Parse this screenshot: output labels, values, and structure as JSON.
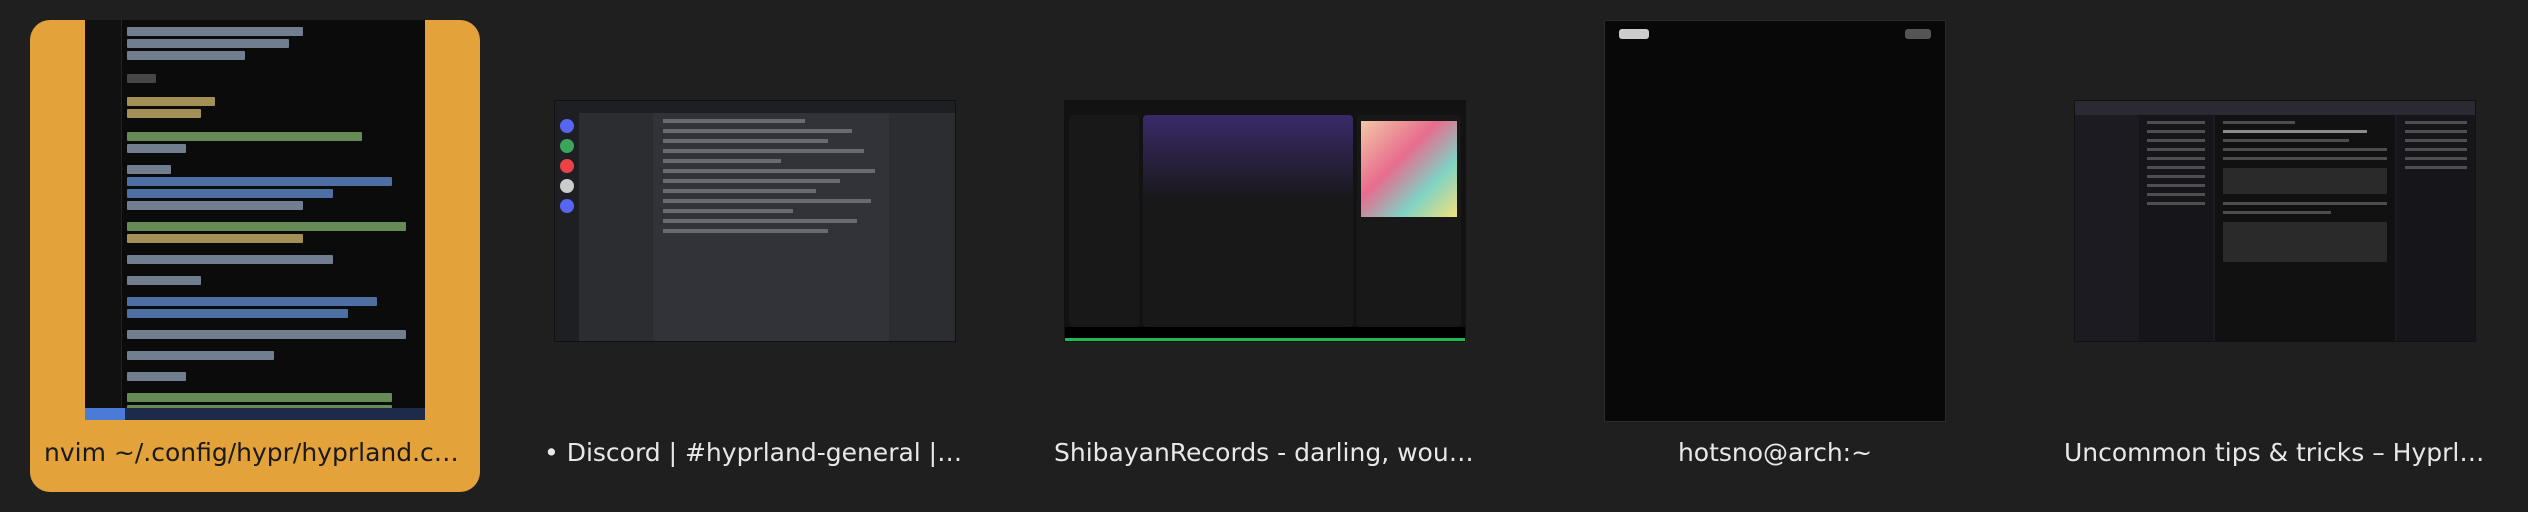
{
  "windows": [
    {
      "title": "nvim ~/.config/hypr/hyprland.conf",
      "active": true
    },
    {
      "title": "• Discord | #hyprland-general | Hyp..."
    },
    {
      "title": "ShibayanRecords - darling, would y..."
    },
    {
      "title": "hotsno@arch:~"
    },
    {
      "title": "Uncommon tips & tricks – Hyprland ..."
    }
  ],
  "colors": {
    "accent": "#e4a23a",
    "background": "#1f1f1f"
  }
}
